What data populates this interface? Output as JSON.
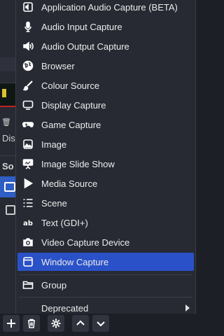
{
  "menu": {
    "items": [
      {
        "label": "Application Audio Capture (BETA)",
        "icon": "app-audio-icon"
      },
      {
        "label": "Audio Input Capture",
        "icon": "microphone-icon"
      },
      {
        "label": "Audio Output Capture",
        "icon": "speaker-icon"
      },
      {
        "label": "Browser",
        "icon": "globe-icon"
      },
      {
        "label": "Colour Source",
        "icon": "brush-icon"
      },
      {
        "label": "Display Capture",
        "icon": "monitor-icon"
      },
      {
        "label": "Game Capture",
        "icon": "gamepad-icon"
      },
      {
        "label": "Image",
        "icon": "image-icon"
      },
      {
        "label": "Image Slide Show",
        "icon": "slideshow-icon"
      },
      {
        "label": "Media Source",
        "icon": "play-icon"
      },
      {
        "label": "Scene",
        "icon": "list-icon"
      },
      {
        "label": "Text (GDI+)",
        "icon": "text-icon"
      },
      {
        "label": "Video Capture Device",
        "icon": "camera-icon"
      },
      {
        "label": "Window Capture",
        "icon": "window-icon",
        "selected": true
      }
    ],
    "group_label": "Group",
    "deprecated_label": "Deprecated"
  },
  "background": {
    "scenes_header_partial": "So",
    "dock_partial": "Dis"
  },
  "colors": {
    "menu_bg": "#272a33",
    "selection": "#2a51c7",
    "app_bg": "#1d1f26"
  }
}
